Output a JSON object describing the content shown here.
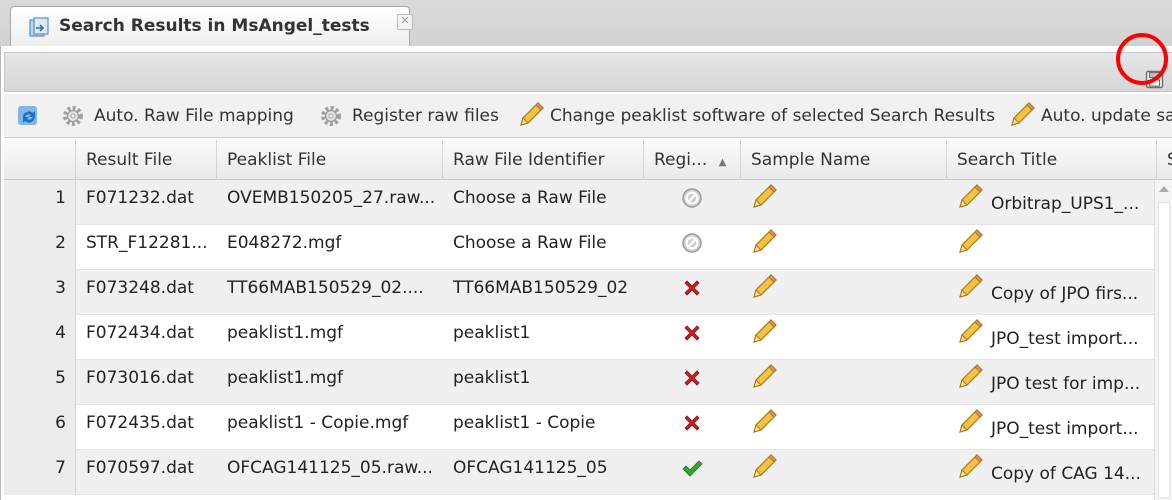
{
  "tab": {
    "title": "Search Results in MsAngel_tests",
    "icon": "search-results-icon",
    "close_glyph": "✕"
  },
  "toolbar": {
    "refresh_icon": "refresh-icon",
    "auto_mapping_label": "Auto. Raw File mapping",
    "register_label": "Register raw files",
    "change_software_label": "Change peaklist software of selected Search Results",
    "auto_update_label": "Auto. update sa"
  },
  "columns": {
    "result_file": "Result File",
    "peaklist_file": "Peaklist File",
    "raw_file_identifier": "Raw File Identifier",
    "registered": "Regi...",
    "sample_name": "Sample Name",
    "search_title": "Search Title",
    "next": "S"
  },
  "sort_glyph": "▲",
  "rows": [
    {
      "num": "1",
      "result_file": "F071232.dat",
      "peaklist_file": "OVEMB150205_27.raw...",
      "raw_file_identifier": "Choose a Raw File",
      "status": "disabled",
      "search_title": "Orbitrap_UPS1_..."
    },
    {
      "num": "2",
      "result_file": "STR_F12281...",
      "peaklist_file": "E048272.mgf",
      "raw_file_identifier": "Choose a Raw File",
      "status": "disabled",
      "search_title": ""
    },
    {
      "num": "3",
      "result_file": "F073248.dat",
      "peaklist_file": "TT66MAB150529_02....",
      "raw_file_identifier": "TT66MAB150529_02",
      "status": "error",
      "search_title": "Copy of JPO firs..."
    },
    {
      "num": "4",
      "result_file": "F072434.dat",
      "peaklist_file": "peaklist1.mgf",
      "raw_file_identifier": "peaklist1",
      "status": "error",
      "search_title": "JPO_test import..."
    },
    {
      "num": "5",
      "result_file": "F073016.dat",
      "peaklist_file": "peaklist1.mgf",
      "raw_file_identifier": "peaklist1",
      "status": "error",
      "search_title": "JPO test for imp..."
    },
    {
      "num": "6",
      "result_file": "F072435.dat",
      "peaklist_file": "peaklist1 - Copie.mgf",
      "raw_file_identifier": "peaklist1 - Copie",
      "status": "error",
      "search_title": "JPO_test import..."
    },
    {
      "num": "7",
      "result_file": "F070597.dat",
      "peaklist_file": "OFCAG141125_05.raw...",
      "raw_file_identifier": "OFCAG141125_05",
      "status": "ok",
      "search_title": "Copy of CAG 14..."
    }
  ],
  "colors": {
    "accent_blue": "#3a8fd6",
    "error_red": "#cc1f1f",
    "ok_green": "#2fa82f",
    "highlight": "#ff0000"
  }
}
